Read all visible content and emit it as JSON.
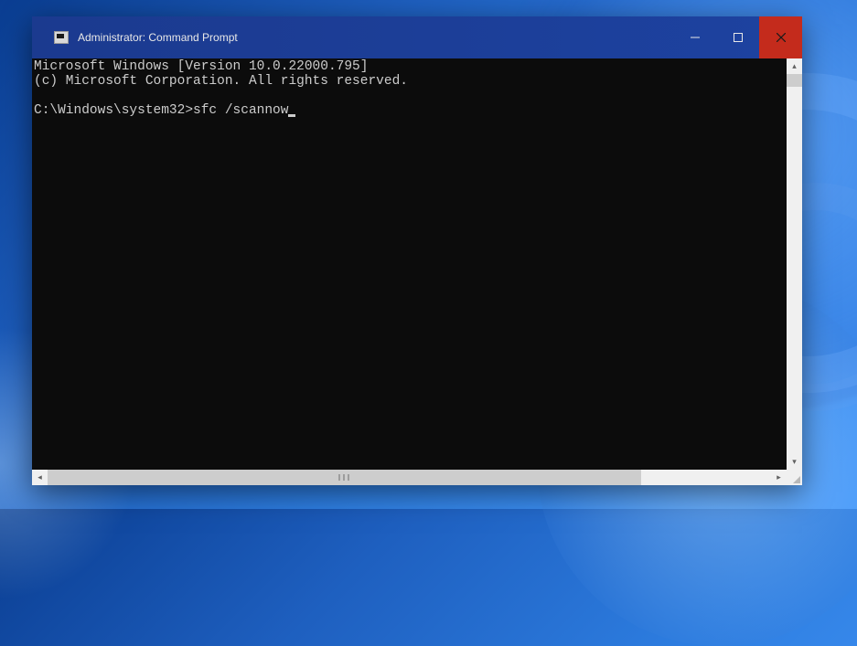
{
  "window": {
    "title": "Administrator: Command Prompt"
  },
  "terminal": {
    "line1": "Microsoft Windows [Version 10.0.22000.795]",
    "line2": "(c) Microsoft Corporation. All rights reserved.",
    "blank": "",
    "prompt": "C:\\Windows\\system32>",
    "command": "sfc /scannow"
  }
}
